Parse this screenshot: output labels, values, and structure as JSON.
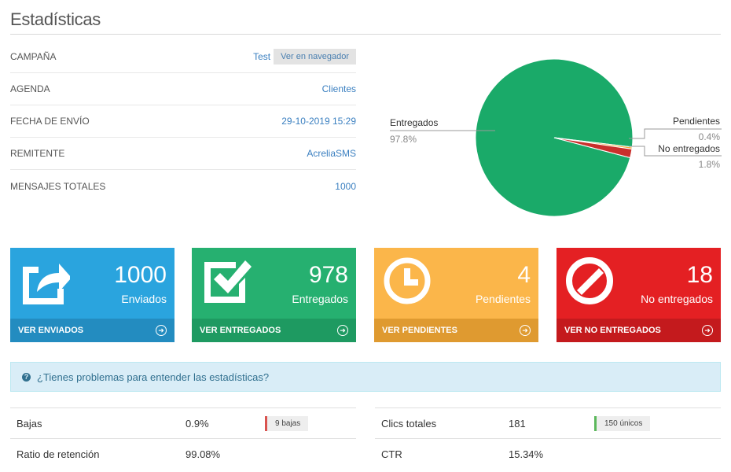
{
  "page": {
    "title": "Estadísticas"
  },
  "info": {
    "campaign_label": "CAMPAÑA",
    "campaign_value": "Test",
    "browser_button": "Ver en navegador",
    "agenda_label": "AGENDA",
    "agenda_value": "Clientes",
    "date_label": "FECHA DE ENVÍO",
    "date_value": "29-10-2019 15:29",
    "sender_label": "REMITENTE",
    "sender_value": "AcreliaSMS",
    "total_label": "MENSAJES TOTALES",
    "total_value": "1000"
  },
  "pie": {
    "slices": [
      {
        "label": "Entregados",
        "percent": "97.8%",
        "value": 97.8,
        "color": "#1aaa69"
      },
      {
        "label": "Pendientes",
        "percent": "0.4%",
        "value": 0.4,
        "color": "#f4a83a"
      },
      {
        "label": "No entregados",
        "percent": "1.8%",
        "value": 1.8,
        "color": "#c9302c"
      }
    ]
  },
  "cards": [
    {
      "number": "1000",
      "label": "Enviados",
      "link": "VER ENVIADOS",
      "color": "#2aa4de",
      "dark": "#238cc0",
      "icon": "share-icon"
    },
    {
      "number": "978",
      "label": "Entregados",
      "link": "VER ENTREGADOS",
      "color": "#26b070",
      "dark": "#1e9a61",
      "icon": "check-icon"
    },
    {
      "number": "4",
      "label": "Pendientes",
      "link": "VER PENDIENTES",
      "color": "#fbb64a",
      "dark": "#df9a30",
      "icon": "clock-icon"
    },
    {
      "number": "18",
      "label": "No entregados",
      "link": "VER NO ENTREGADOS",
      "color": "#e42023",
      "dark": "#c41a1d",
      "icon": "ban-icon"
    }
  ],
  "help": {
    "text": "¿Tienes problemas para entender las estadísticas?"
  },
  "stats_left": [
    {
      "label": "Bajas",
      "value": "0.9%",
      "badge": "9 bajas",
      "badge_color": "#d9534f"
    },
    {
      "label": "Ratio de retención",
      "value": "99.08%"
    }
  ],
  "stats_right": [
    {
      "label": "Clics totales",
      "value": "181",
      "badge": "150 únicos",
      "badge_color": "#5cb85c"
    },
    {
      "label": "CTR",
      "value": "15.34%"
    }
  ]
}
